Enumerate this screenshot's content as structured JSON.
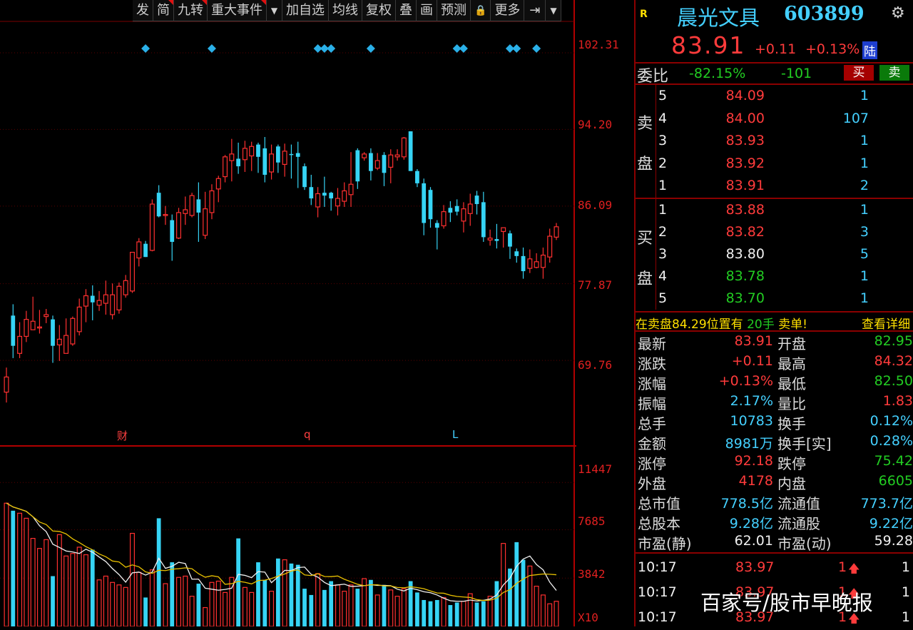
{
  "toolbar": {
    "items": [
      "发",
      "简",
      "九转",
      "重大事件",
      "▼",
      "加自选",
      "均线",
      "复权",
      "叠",
      "画",
      "预测",
      "🔒",
      "更多",
      "⇥",
      "▼"
    ]
  },
  "price_axis": {
    "labels": [
      "102.31",
      "94.20",
      "86.09",
      "77.87",
      "69.76"
    ]
  },
  "volume_axis": {
    "labels": [
      "11447",
      "7685",
      "3842",
      "X10"
    ]
  },
  "event_marks": {
    "cai": "财",
    "q": "q",
    "l": "L"
  },
  "chart_data": {
    "type": "candlestick",
    "price_range": [
      63.5,
      104.5
    ],
    "price_ticks": [
      102.31,
      94.2,
      86.09,
      77.87,
      69.76
    ],
    "volume_range": [
      0,
      13500
    ],
    "volume_ticks": [
      11447,
      7685,
      3842
    ],
    "candles": [
      {
        "o": 66.4,
        "c": 68.0,
        "h": 69.0,
        "l": 65.3
      },
      {
        "o": 74.5,
        "c": 71.3,
        "h": 75.7,
        "l": 70.0
      },
      {
        "o": 70.5,
        "c": 72.3,
        "h": 73.8,
        "l": 70.0
      },
      {
        "o": 72.3,
        "c": 74.1,
        "h": 75.0,
        "l": 71.7
      },
      {
        "o": 73.0,
        "c": 73.9,
        "h": 76.5,
        "l": 73.0
      },
      {
        "o": 73.2,
        "c": 73.3,
        "h": 75.1,
        "l": 72.6
      },
      {
        "o": 74.4,
        "c": 74.6,
        "h": 75.2,
        "l": 73.7
      },
      {
        "o": 74.1,
        "c": 71.3,
        "h": 74.5,
        "l": 69.5
      },
      {
        "o": 71.4,
        "c": 72.0,
        "h": 73.5,
        "l": 69.7
      },
      {
        "o": 70.5,
        "c": 72.4,
        "h": 74.2,
        "l": 70.5
      },
      {
        "o": 71.5,
        "c": 74.2,
        "h": 74.4,
        "l": 71.3
      },
      {
        "o": 72.8,
        "c": 75.4,
        "h": 76.3,
        "l": 72.4
      },
      {
        "o": 75.5,
        "c": 76.6,
        "h": 77.3,
        "l": 73.8
      },
      {
        "o": 76.6,
        "c": 75.9,
        "h": 77.7,
        "l": 74.0
      },
      {
        "o": 75.6,
        "c": 76.1,
        "h": 77.1,
        "l": 75.0
      },
      {
        "o": 75.8,
        "c": 76.7,
        "h": 78.2,
        "l": 74.6
      },
      {
        "o": 74.6,
        "c": 76.7,
        "h": 77.9,
        "l": 74.1
      },
      {
        "o": 75.1,
        "c": 77.6,
        "h": 78.0,
        "l": 74.7
      },
      {
        "o": 76.7,
        "c": 78.2,
        "h": 78.8,
        "l": 76.4
      },
      {
        "o": 77.1,
        "c": 81.2,
        "h": 81.2,
        "l": 76.9
      },
      {
        "o": 80.6,
        "c": 82.3,
        "h": 82.7,
        "l": 79.7
      },
      {
        "o": 82.1,
        "c": 80.7,
        "h": 82.4,
        "l": 80.7
      },
      {
        "o": 81.4,
        "c": 86.3,
        "h": 86.8,
        "l": 81.3
      },
      {
        "o": 87.5,
        "c": 85.0,
        "h": 88.3,
        "l": 84.9
      },
      {
        "o": 85.1,
        "c": 85.2,
        "h": 86.1,
        "l": 84.1
      },
      {
        "o": 84.6,
        "c": 82.3,
        "h": 85.2,
        "l": 80.3
      },
      {
        "o": 82.7,
        "c": 85.4,
        "h": 85.9,
        "l": 82.6
      },
      {
        "o": 85.3,
        "c": 85.7,
        "h": 87.1,
        "l": 84.1
      },
      {
        "o": 85.1,
        "c": 87.2,
        "h": 87.5,
        "l": 84.9
      },
      {
        "o": 86.8,
        "c": 85.4,
        "h": 88.6,
        "l": 82.3
      },
      {
        "o": 83.0,
        "c": 85.8,
        "h": 87.6,
        "l": 82.6
      },
      {
        "o": 85.4,
        "c": 87.7,
        "h": 88.4,
        "l": 84.7
      },
      {
        "o": 87.9,
        "c": 89.0,
        "h": 89.3,
        "l": 86.5
      },
      {
        "o": 89.2,
        "c": 91.3,
        "h": 91.5,
        "l": 88.6
      },
      {
        "o": 90.9,
        "c": 91.6,
        "h": 93.2,
        "l": 88.7
      },
      {
        "o": 91.1,
        "c": 90.3,
        "h": 92.8,
        "l": 89.5
      },
      {
        "o": 91.0,
        "c": 92.2,
        "h": 93.0,
        "l": 89.7
      },
      {
        "o": 91.4,
        "c": 92.4,
        "h": 92.9,
        "l": 89.8
      },
      {
        "o": 92.6,
        "c": 91.3,
        "h": 92.8,
        "l": 89.6
      },
      {
        "o": 92.2,
        "c": 89.4,
        "h": 93.4,
        "l": 88.6
      },
      {
        "o": 89.7,
        "c": 91.6,
        "h": 92.6,
        "l": 88.9
      },
      {
        "o": 92.4,
        "c": 90.7,
        "h": 92.6,
        "l": 89.6
      },
      {
        "o": 90.5,
        "c": 91.9,
        "h": 92.7,
        "l": 89.2
      },
      {
        "o": 91.6,
        "c": 91.5,
        "h": 92.6,
        "l": 89.0
      },
      {
        "o": 91.7,
        "c": 91.3,
        "h": 92.9,
        "l": 88.0
      },
      {
        "o": 90.3,
        "c": 88.1,
        "h": 90.6,
        "l": 87.8
      },
      {
        "o": 88.1,
        "c": 86.9,
        "h": 89.4,
        "l": 86.2
      },
      {
        "o": 86.0,
        "c": 87.4,
        "h": 88.1,
        "l": 84.9
      },
      {
        "o": 87.5,
        "c": 87.2,
        "h": 89.2,
        "l": 86.0
      },
      {
        "o": 87.5,
        "c": 86.9,
        "h": 87.6,
        "l": 85.6
      },
      {
        "o": 86.1,
        "c": 86.9,
        "h": 88.0,
        "l": 85.1
      },
      {
        "o": 86.6,
        "c": 87.7,
        "h": 88.6,
        "l": 86.0
      },
      {
        "o": 87.3,
        "c": 88.4,
        "h": 91.8,
        "l": 86.0
      },
      {
        "o": 92.0,
        "c": 88.7,
        "h": 92.2,
        "l": 87.9
      },
      {
        "o": 91.2,
        "c": 91.6,
        "h": 91.8,
        "l": 90.9
      },
      {
        "o": 91.7,
        "c": 89.8,
        "h": 92.2,
        "l": 88.8
      },
      {
        "o": 90.1,
        "c": 90.9,
        "h": 91.7,
        "l": 89.9
      },
      {
        "o": 91.5,
        "c": 89.6,
        "h": 91.8,
        "l": 88.2
      },
      {
        "o": 90.2,
        "c": 91.5,
        "h": 92.1,
        "l": 88.5
      },
      {
        "o": 91.3,
        "c": 91.5,
        "h": 92.1,
        "l": 90.9
      },
      {
        "o": 91.3,
        "c": 93.3,
        "h": 93.4,
        "l": 91.0
      },
      {
        "o": 94.0,
        "c": 89.8,
        "h": 94.0,
        "l": 89.8
      },
      {
        "o": 89.8,
        "c": 88.5,
        "h": 90.0,
        "l": 88.1
      },
      {
        "o": 88.5,
        "c": 84.3,
        "h": 89.0,
        "l": 83.0
      },
      {
        "o": 87.8,
        "c": 84.7,
        "h": 88.1,
        "l": 83.8
      },
      {
        "o": 84.3,
        "c": 83.8,
        "h": 84.6,
        "l": 81.5
      },
      {
        "o": 84.0,
        "c": 85.5,
        "h": 86.2,
        "l": 83.7
      },
      {
        "o": 85.9,
        "c": 85.4,
        "h": 86.6,
        "l": 84.4
      },
      {
        "o": 86.1,
        "c": 85.5,
        "h": 86.8,
        "l": 85.1
      },
      {
        "o": 84.5,
        "c": 85.8,
        "h": 86.5,
        "l": 83.3
      },
      {
        "o": 85.3,
        "c": 86.3,
        "h": 87.4,
        "l": 84.0
      },
      {
        "o": 87.2,
        "c": 86.3,
        "h": 87.7,
        "l": 85.2
      },
      {
        "o": 86.5,
        "c": 82.8,
        "h": 87.6,
        "l": 82.3
      },
      {
        "o": 82.5,
        "c": 82.7,
        "h": 83.6,
        "l": 81.9
      },
      {
        "o": 82.6,
        "c": 82.4,
        "h": 84.2,
        "l": 81.6
      },
      {
        "o": 83.4,
        "c": 83.8,
        "h": 83.8,
        "l": 81.7
      },
      {
        "o": 83.2,
        "c": 81.8,
        "h": 83.5,
        "l": 80.5
      },
      {
        "o": 81.3,
        "c": 80.8,
        "h": 81.6,
        "l": 80.1
      },
      {
        "o": 80.8,
        "c": 79.2,
        "h": 81.7,
        "l": 78.4
      },
      {
        "o": 79.5,
        "c": 80.5,
        "h": 81.5,
        "l": 79.0
      },
      {
        "o": 79.6,
        "c": 80.2,
        "h": 81.1,
        "l": 79.5
      },
      {
        "o": 79.6,
        "c": 80.9,
        "h": 81.7,
        "l": 78.4
      },
      {
        "o": 80.7,
        "c": 82.9,
        "h": 83.7,
        "l": 80.1
      },
      {
        "o": 82.8,
        "c": 83.9,
        "h": 84.3,
        "l": 82.5
      }
    ],
    "volumes": [
      9800,
      9200,
      9000,
      8600,
      7000,
      6200,
      6900,
      4000,
      7300,
      5600,
      5800,
      6300,
      5700,
      6100,
      3700,
      4000,
      3500,
      3300,
      3100,
      7400,
      4300,
      2300,
      4500,
      8600,
      3400,
      5100,
      3900,
      4000,
      2400,
      3400,
      1500,
      3500,
      3600,
      2700,
      3900,
      7000,
      3100,
      2700,
      5100,
      3700,
      2800,
      5400,
      5300,
      5000,
      4900,
      3000,
      2500,
      4200,
      2900,
      3600,
      3300,
      2800,
      3300,
      3000,
      3800,
      3700,
      2500,
      3300,
      2900,
      2400,
      3000,
      3600,
      2700,
      2100,
      2000,
      2100,
      2300,
      1700,
      1900,
      2000,
      2600,
      1900,
      2000,
      2400,
      3600,
      6600,
      4600,
      6700,
      5300,
      4800,
      3200,
      2500,
      1800,
      2000
    ]
  },
  "stock": {
    "r_flag": "R",
    "name": "晨光文具",
    "code": "603899",
    "price": "83.91",
    "change": "+0.11",
    "pct": "+0.13%",
    "tag": "陆"
  },
  "weibi": {
    "label": "委比",
    "pct": "-82.15%",
    "diff": "-101",
    "buy": "买",
    "sell": "卖"
  },
  "sell_side": {
    "label1": "卖",
    "label2": "盘",
    "rows": [
      {
        "lv": "5",
        "price": "84.09",
        "vol": "1"
      },
      {
        "lv": "4",
        "price": "84.00",
        "vol": "107"
      },
      {
        "lv": "3",
        "price": "83.93",
        "vol": "1"
      },
      {
        "lv": "2",
        "price": "83.92",
        "vol": "1"
      },
      {
        "lv": "1",
        "price": "83.91",
        "vol": "2"
      }
    ]
  },
  "buy_side": {
    "label1": "买",
    "label2": "盘",
    "rows": [
      {
        "lv": "1",
        "price": "83.88",
        "vol": "1",
        "color": "#ff3b3b"
      },
      {
        "lv": "2",
        "price": "83.82",
        "vol": "3",
        "color": "#ff3b3b"
      },
      {
        "lv": "3",
        "price": "83.80",
        "vol": "5",
        "color": "#f0f0f0"
      },
      {
        "lv": "4",
        "price": "83.78",
        "vol": "1",
        "color": "#22cc22"
      },
      {
        "lv": "5",
        "price": "83.70",
        "vol": "1",
        "color": "#22cc22"
      }
    ]
  },
  "notice": {
    "text1": "在卖盘",
    "price": "84.29",
    "text2": "位置有",
    "qty": "20手",
    "text3": "卖单!",
    "link": "查看详细"
  },
  "stats": [
    {
      "l1": "最新",
      "v1": "83.91",
      "c1": "#ff3b3b",
      "l2": "开盘",
      "v2": "82.95",
      "c2": "#22cc22"
    },
    {
      "l1": "涨跌",
      "v1": "+0.11",
      "c1": "#ff3b3b",
      "l2": "最高",
      "v2": "84.32",
      "c2": "#ff3b3b"
    },
    {
      "l1": "涨幅",
      "v1": "+0.13%",
      "c1": "#ff3b3b",
      "l2": "最低",
      "v2": "82.50",
      "c2": "#22cc22"
    },
    {
      "l1": "振幅",
      "v1": "2.17%",
      "c1": "#44d0ff",
      "l2": "量比",
      "v2": "1.83",
      "c2": "#ff3b3b"
    },
    {
      "l1": "总手",
      "v1": "10783",
      "c1": "#44d0ff",
      "l2": "换手",
      "v2": "0.12%",
      "c2": "#44d0ff"
    },
    {
      "l1": "金额",
      "v1": "8981万",
      "c1": "#44d0ff",
      "l2": "换手[实]",
      "v2": "0.28%",
      "c2": "#44d0ff"
    },
    {
      "l1": "涨停",
      "v1": "92.18",
      "c1": "#ff3b3b",
      "l2": "跌停",
      "v2": "75.42",
      "c2": "#22cc22"
    },
    {
      "l1": "外盘",
      "v1": "4178",
      "c1": "#ff3b3b",
      "l2": "内盘",
      "v2": "6605",
      "c2": "#22cc22"
    },
    {
      "l1": "总市值",
      "v1": "778.5亿",
      "c1": "#44d0ff",
      "l2": "流通值",
      "v2": "773.7亿",
      "c2": "#44d0ff"
    },
    {
      "l1": "总股本",
      "v1": "9.28亿",
      "c1": "#44d0ff",
      "l2": "流通股",
      "v2": "9.22亿",
      "c2": "#44d0ff"
    },
    {
      "l1": "市盈(静)",
      "v1": "62.01",
      "c1": "#f0f0f0",
      "l2": "市盈(动)",
      "v2": "59.28",
      "c2": "#f0f0f0"
    }
  ],
  "trades": [
    {
      "time": "10:17",
      "price": "83.97",
      "qty": "1",
      "arrow": "🡅",
      "n": "1"
    },
    {
      "time": "10:17",
      "price": "83.97",
      "qty": "1",
      "arrow": "🡅",
      "n": "1"
    },
    {
      "time": "10:17",
      "price": "83.97",
      "qty": "1",
      "arrow": "🡅",
      "n": "1"
    }
  ],
  "watermark": "百家号/股市早晚报"
}
